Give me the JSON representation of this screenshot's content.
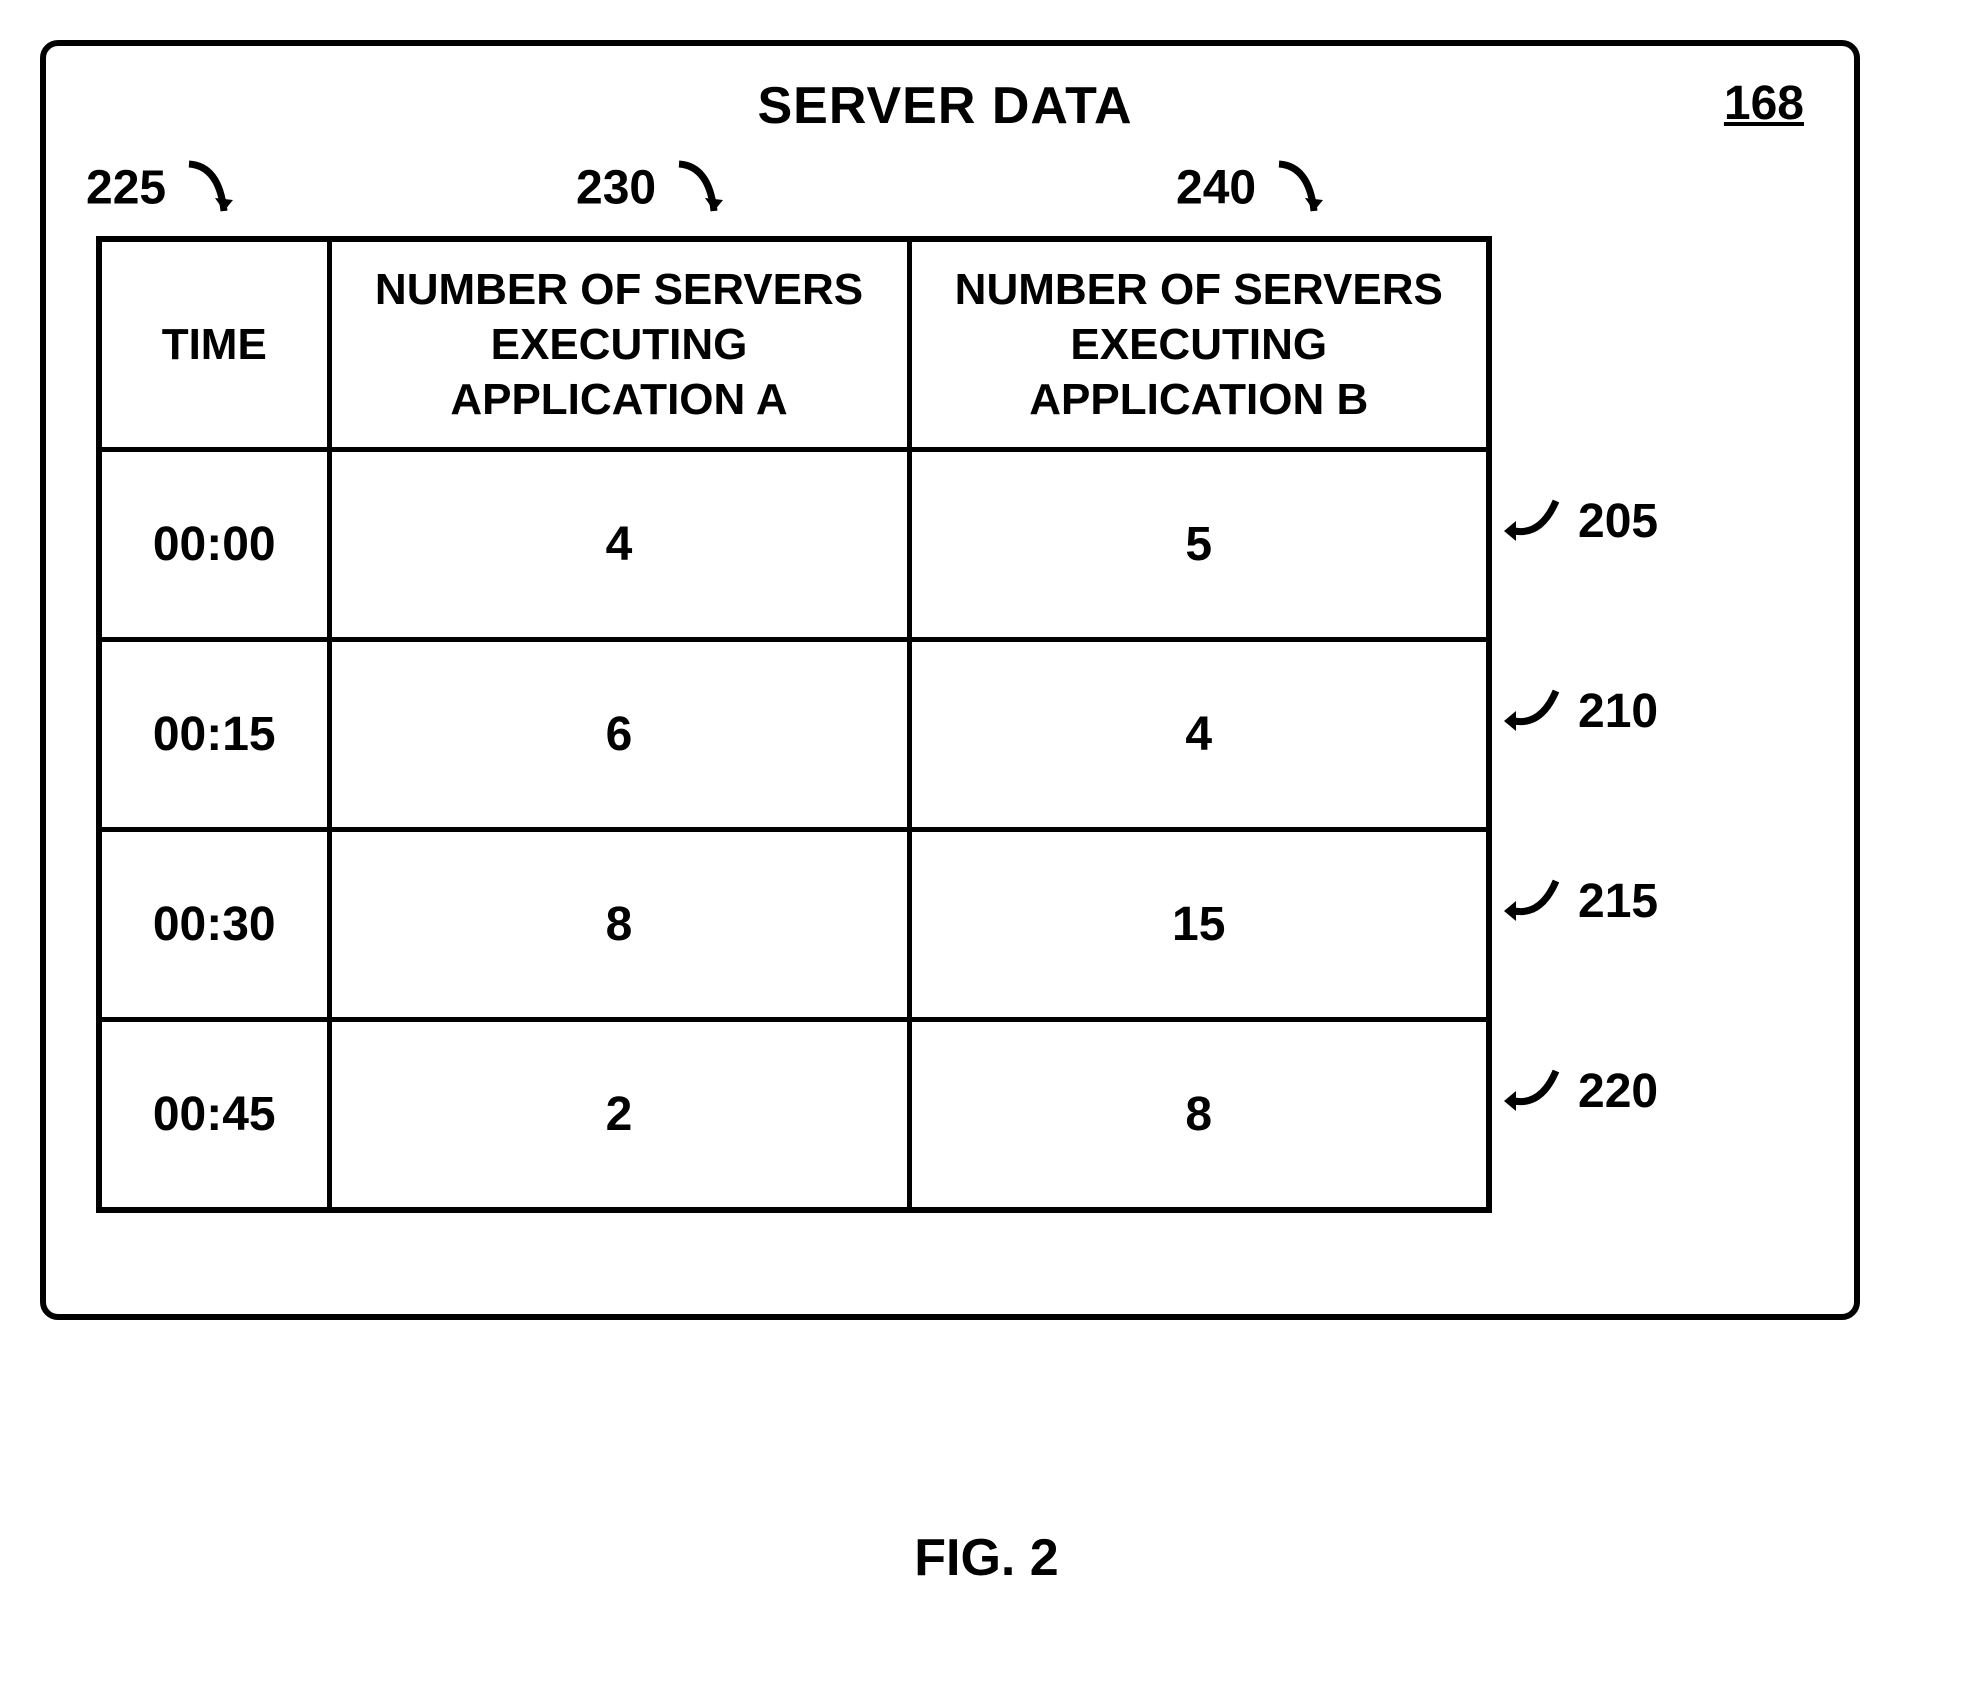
{
  "title": "SERVER DATA",
  "figure_id": "168",
  "figure_label": "FIG. 2",
  "column_refs": {
    "time": "225",
    "app_a": "230",
    "app_b": "240"
  },
  "headers": {
    "time": "TIME",
    "app_a": "NUMBER OF SERVERS EXECUTING APPLICATION A",
    "app_b": "NUMBER OF SERVERS EXECUTING APPLICATION B"
  },
  "rows": [
    {
      "time": "00:00",
      "app_a": "4",
      "app_b": "5",
      "ref": "205"
    },
    {
      "time": "00:15",
      "app_a": "6",
      "app_b": "4",
      "ref": "210"
    },
    {
      "time": "00:30",
      "app_a": "8",
      "app_b": "15",
      "ref": "215"
    },
    {
      "time": "00:45",
      "app_a": "2",
      "app_b": "8",
      "ref": "220"
    }
  ],
  "chart_data": {
    "type": "table",
    "title": "SERVER DATA",
    "columns": [
      "TIME",
      "NUMBER OF SERVERS EXECUTING APPLICATION A",
      "NUMBER OF SERVERS EXECUTING APPLICATION B"
    ],
    "data": [
      [
        "00:00",
        4,
        5
      ],
      [
        "00:15",
        6,
        4
      ],
      [
        "00:30",
        8,
        15
      ],
      [
        "00:45",
        2,
        8
      ]
    ]
  }
}
